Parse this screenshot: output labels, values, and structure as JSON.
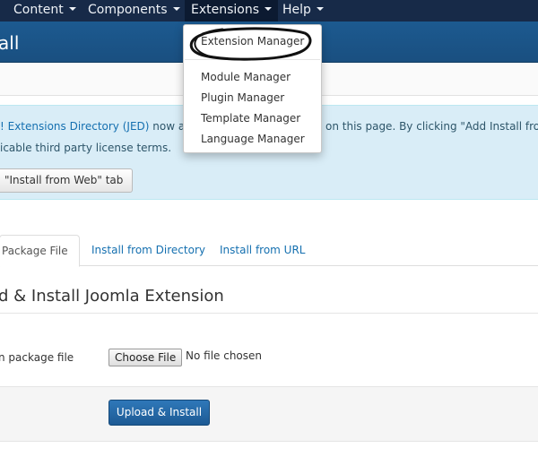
{
  "nav": {
    "items": [
      {
        "label": "Content"
      },
      {
        "label": "Components"
      },
      {
        "label": "Extensions"
      },
      {
        "label": "Help"
      }
    ]
  },
  "titlebar": {
    "title": "all"
  },
  "alert": {
    "line1_link": "! Extensions Directory (JED)",
    "line1_text_a": " now ava",
    "line1_text_b": "on this page.  By clicking \"Add Install from",
    "line2_text": "icable third party license terms.",
    "button_label": "\"Install from Web\" tab"
  },
  "tabs": [
    {
      "label": "Package File"
    },
    {
      "label": "Install from Directory"
    },
    {
      "label": "Install from URL"
    }
  ],
  "panel": {
    "heading": "d & Install Joomla Extension",
    "field_label": "n package file",
    "choose_label": "Choose File",
    "no_file_text": "No file chosen",
    "upload_label": "Upload & Install"
  },
  "dropdown": {
    "items": [
      {
        "label": "Extension Manager"
      },
      {
        "label": "Module Manager"
      },
      {
        "label": "Plugin Manager"
      },
      {
        "label": "Template Manager"
      },
      {
        "label": "Language Manager"
      }
    ]
  }
}
